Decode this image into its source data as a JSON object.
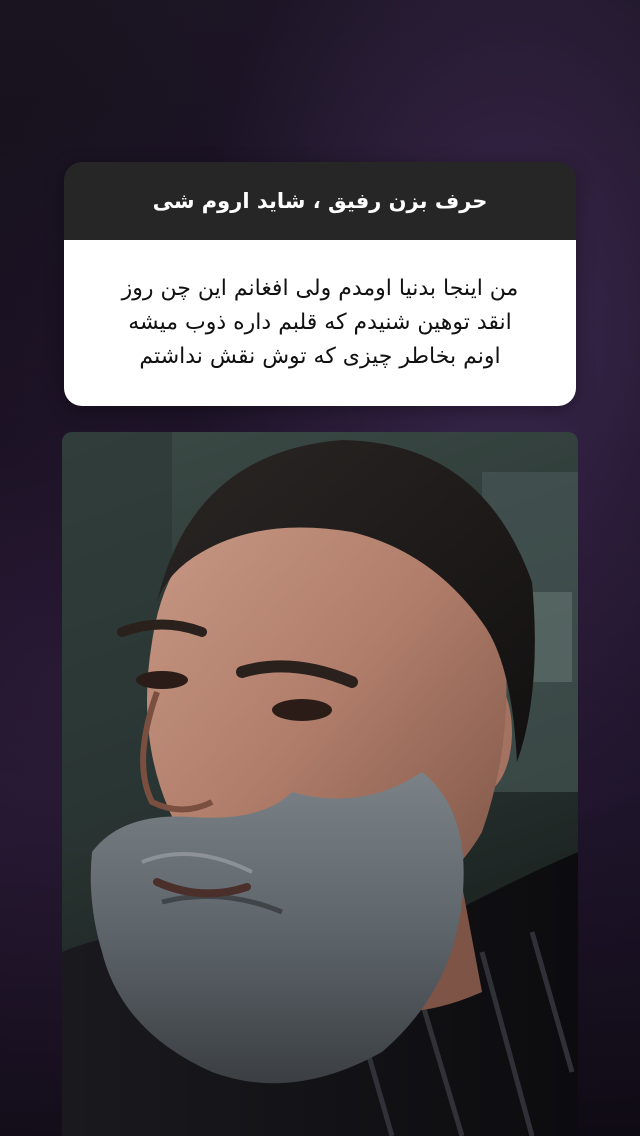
{
  "question": {
    "title": "حرف بزن رفیق ، شاید اروم شی"
  },
  "answer": {
    "lines": [
      "من اینجا بدنیا اومدم ولی افغانم این چن روز",
      "انقد توهین شنیدم که قلبم داره ذوب میشه",
      "اونم بخاطر چیزی که توش نقش نداشتم"
    ]
  },
  "photo": {
    "subject": "bearded-man-portrait"
  }
}
